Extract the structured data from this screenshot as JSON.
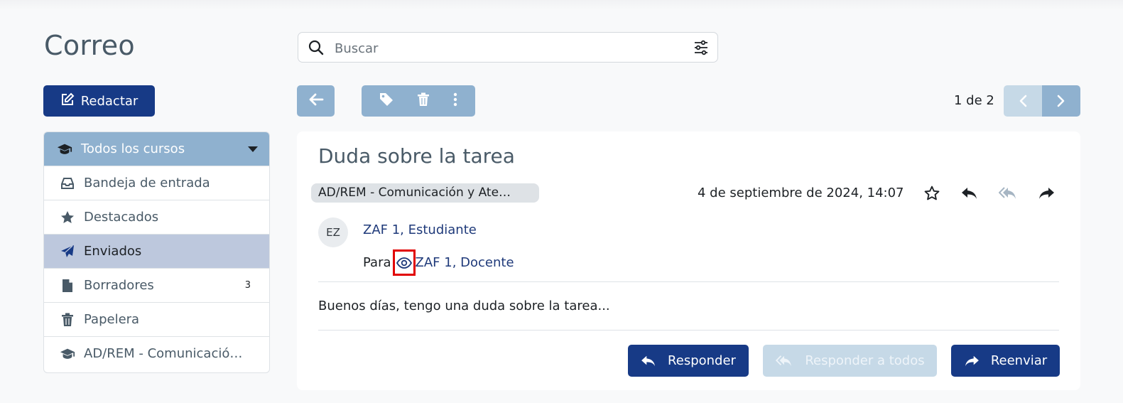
{
  "app": {
    "title": "Correo"
  },
  "search": {
    "placeholder": "Buscar"
  },
  "compose": {
    "label": "Redactar"
  },
  "courses": {
    "selected": "Todos los cursos",
    "items": [
      {
        "label": "Bandeja de entrada",
        "icon": "inbox-icon"
      },
      {
        "label": "Destacados",
        "icon": "star-icon"
      },
      {
        "label": "Enviados",
        "icon": "send-icon",
        "active": true
      },
      {
        "label": "Borradores",
        "icon": "file-icon",
        "badge": "3"
      },
      {
        "label": "Papelera",
        "icon": "trash-icon"
      },
      {
        "label": "AD/REM - Comunicació…",
        "icon": "graduation-cap-icon"
      }
    ]
  },
  "pager": {
    "text": "1 de 2"
  },
  "message": {
    "subject": "Duda sobre la tarea",
    "course": "AD/REM - Comunicación y Ate…",
    "date": "4 de septiembre de 2024, 14:07",
    "avatar_initials": "EZ",
    "sender": "ZAF 1, Estudiante",
    "to_label": "Para",
    "recipient": "ZAF 1, Docente",
    "body": "Buenos días, tengo una duda sobre la tarea..."
  },
  "actions": {
    "reply": "Responder",
    "reply_all": "Responder a todos",
    "forward": "Reenviar"
  },
  "colors": {
    "primary": "#173a86",
    "accent": "#8fb1cf",
    "active_item": "#bdc8dd",
    "highlight": "#e10000"
  }
}
